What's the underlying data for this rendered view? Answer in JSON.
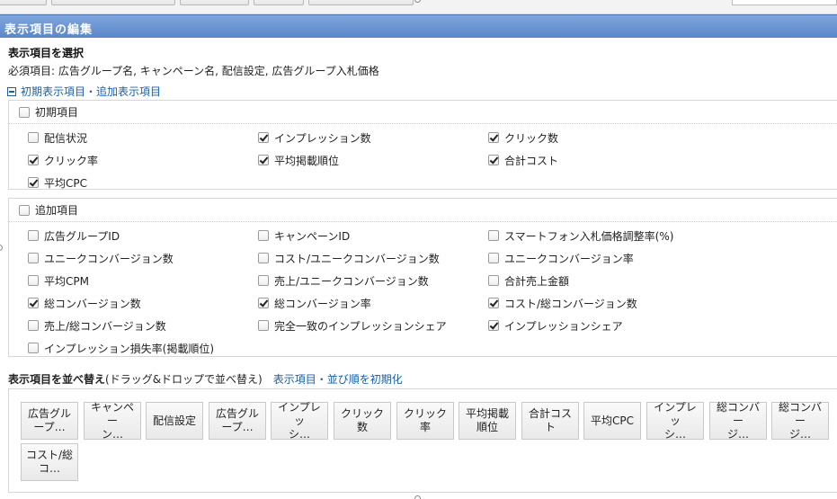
{
  "panel": {
    "title": "表示項目の編集"
  },
  "select_section": {
    "title": "表示項目を選択",
    "required_label": "必須項目: 広告グループ名, キャンペーン名, 配信設定, 広告グループ入札価格",
    "toggle_label": "初期表示項目・追加表示項目"
  },
  "initial_group": {
    "label": "初期項目",
    "checked": false,
    "items": [
      {
        "label": "配信状況",
        "checked": false
      },
      {
        "label": "インプレッション数",
        "checked": true
      },
      {
        "label": "クリック数",
        "checked": true
      },
      {
        "label": "クリック率",
        "checked": true
      },
      {
        "label": "平均掲載順位",
        "checked": true
      },
      {
        "label": "合計コスト",
        "checked": true
      },
      {
        "label": "平均CPC",
        "checked": true
      }
    ]
  },
  "additional_group": {
    "label": "追加項目",
    "checked": false,
    "items": [
      {
        "label": "広告グループID",
        "checked": false
      },
      {
        "label": "キャンペーンID",
        "checked": false
      },
      {
        "label": "スマートフォン入札価格調整率(%)",
        "checked": false
      },
      {
        "label": "ユニークコンバージョン数",
        "checked": false
      },
      {
        "label": "コスト/ユニークコンバージョン数",
        "checked": false
      },
      {
        "label": "ユニークコンバージョン率",
        "checked": false
      },
      {
        "label": "平均CPM",
        "checked": false
      },
      {
        "label": "売上/ユニークコンバージョン数",
        "checked": false
      },
      {
        "label": "合計売上金額",
        "checked": false
      },
      {
        "label": "総コンバージョン数",
        "checked": true
      },
      {
        "label": "総コンバージョン率",
        "checked": true
      },
      {
        "label": "コスト/総コンバージョン数",
        "checked": true
      },
      {
        "label": "売上/総コンバージョン数",
        "checked": false
      },
      {
        "label": "完全一致のインプレッションシェア",
        "checked": false
      },
      {
        "label": "インプレッションシェア",
        "checked": true
      },
      {
        "label": "インプレッション損失率(掲載順位)",
        "checked": false
      }
    ]
  },
  "sort_section": {
    "title": "表示項目を並べ替え",
    "hint": "(ドラッグ&ドロップで並べ替え)",
    "reset_link": "表示項目・並び順を初期化",
    "chips": [
      "広告グル\nープ…",
      "キャンペー\nン…",
      "配信設定",
      "広告グル\nープ…",
      "インプレッ\nシ…",
      "クリック数",
      "クリック率",
      "平均掲載\n順位",
      "合計コスト",
      "平均CPC",
      "インプレッ\nシ…",
      "総コンバー\nジ…",
      "総コンバー\nジ…",
      "コスト/総\nコ…"
    ]
  }
}
